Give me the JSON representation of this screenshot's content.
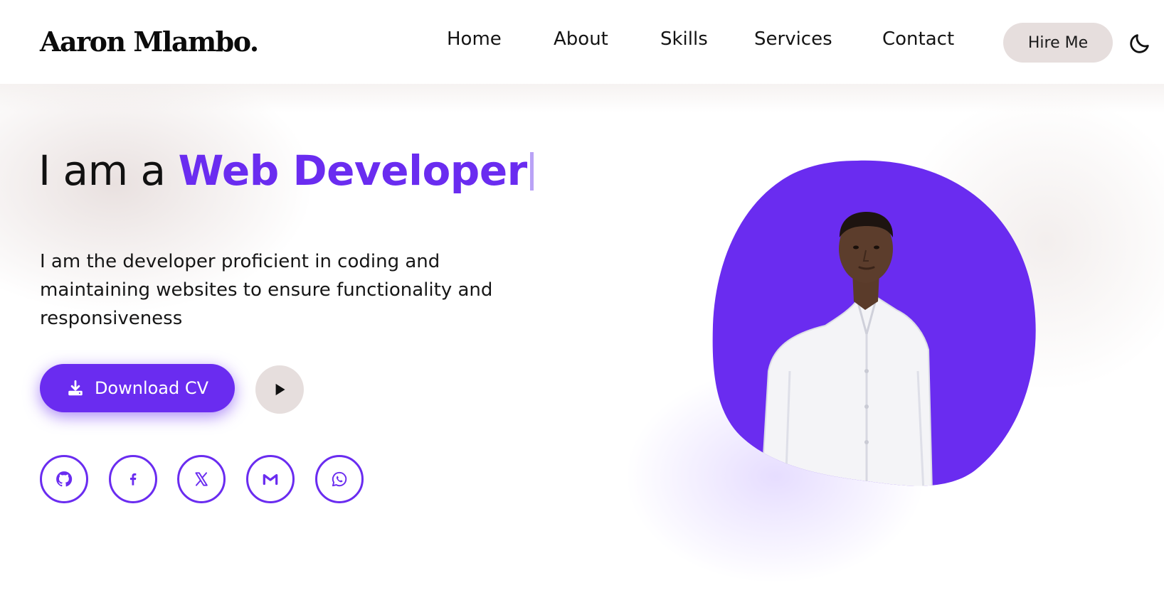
{
  "header": {
    "logo": "Aaron Mlambo.",
    "nav": [
      "Home",
      "About",
      "Skills",
      "Services",
      "Contact"
    ],
    "hire_label": "Hire Me",
    "theme_icon": "moon-icon"
  },
  "hero": {
    "headline_prefix": "I am a",
    "headline_role": "Web Developer",
    "description": "I am the developer proficient in coding and maintaining websites to ensure functionality and responsiveness",
    "cv_label": "Download CV",
    "cv_icon": "download-icon",
    "play_icon": "play-icon"
  },
  "socials": [
    "github-icon",
    "facebook-icon",
    "x-icon",
    "gmail-icon",
    "whatsapp-icon"
  ],
  "colors": {
    "accent": "#6a2cf0",
    "soft_button": "#e6dedd",
    "text": "#111111",
    "background": "#ffffff"
  }
}
